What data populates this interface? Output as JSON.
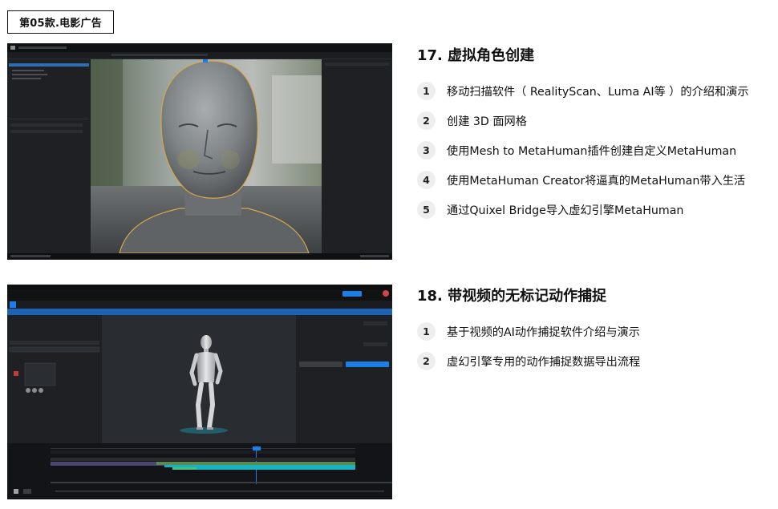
{
  "tag": {
    "label": "第05款.电影广告"
  },
  "sections": [
    {
      "title": "17. 虚拟角色创建",
      "items": [
        {
          "num": "1",
          "text": "移动扫描软件（ RealityScan、Luma AI等 ）的介绍和演示"
        },
        {
          "num": "2",
          "text": "创建 3D 面网格"
        },
        {
          "num": "3",
          "text": "使用Mesh to MetaHuman插件创建自定义MetaHuman"
        },
        {
          "num": "4",
          "text": "使用MetaHuman Creator将逼真的MetaHuman带入生活"
        },
        {
          "num": "5",
          "text": "通过Quixel Bridge导入虚幻引擎MetaHuman"
        }
      ]
    },
    {
      "title": "18. 带视频的无标记动作捕捉",
      "items": [
        {
          "num": "1",
          "text": "基于视频的AI动作捕捉软件介绍与演示"
        },
        {
          "num": "2",
          "text": "虚幻引擎专用的动作捕捉数据导出流程"
        }
      ]
    }
  ],
  "colors": {
    "editor_bg": "#16181b",
    "panel_bg": "#1e2024",
    "accent_blue": "#1c7fe6",
    "mesh_outline": "#d6a84a",
    "track_teal": "#18b3c0",
    "track_green": "#48c27a",
    "number_badge_bg": "#eeeeee"
  }
}
